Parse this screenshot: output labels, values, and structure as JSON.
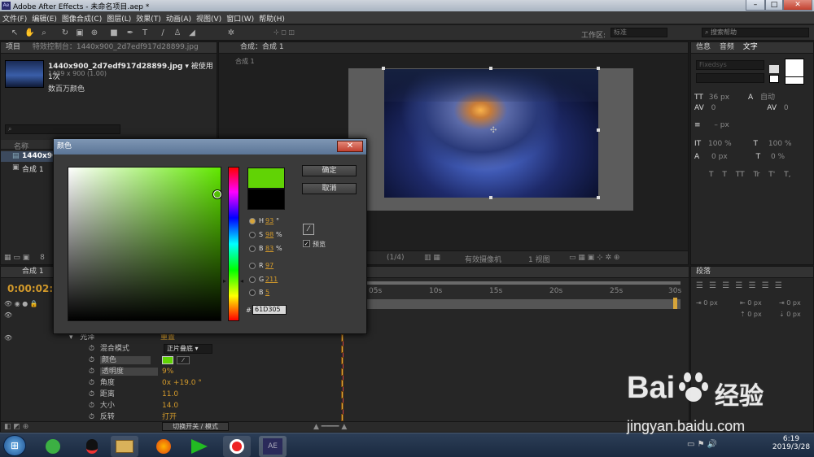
{
  "app": {
    "title": "Adobe After Effects - 未命名项目.aep *",
    "min": "–",
    "max": "□",
    "close": "✕",
    "ae_icon": "Ae"
  },
  "menu": [
    "文件(F)",
    "编辑(E)",
    "图像合成(C)",
    "图层(L)",
    "效果(T)",
    "动画(A)",
    "视图(V)",
    "窗口(W)",
    "帮助(H)"
  ],
  "toolbar": {
    "workspace_label": "工作区:",
    "workspace_value": "标准",
    "search_placeholder": "搜索帮助"
  },
  "project": {
    "tab_project": "项目",
    "tab_effects": "特效控制台：1440x900_2d7edf917d28899.jpg",
    "file_name": "1440x900_2d7edf917d28899.jpg",
    "used": "▾ 被使用 1次",
    "dims": "1439 x 900 (1.00)",
    "colors": "数百万颜色",
    "col_name": "名称",
    "items": [
      "1440x90",
      "合成 1"
    ],
    "bpc": "8"
  },
  "comp": {
    "tab": "合成：合成 1",
    "sub": "合成 1",
    "zoom": "(1/4)",
    "camera": "有效摄像机",
    "views": "1 视图"
  },
  "text_panel": {
    "tabs": [
      "信息",
      "音频",
      "文字"
    ],
    "font": "Fixedsys",
    "size": "36 px",
    "leading": "自动",
    "kern": "0",
    "tracking": "0",
    "stroke": "– px",
    "vscale": "100 %",
    "hscale": "100 %",
    "baseline": "0 px",
    "tsume": "0 %",
    "styles": [
      "T",
      "T",
      "TT",
      "Tr",
      "T'",
      "T,"
    ]
  },
  "paragraph": {
    "tab": "段落",
    "indent": [
      "0 px",
      "0 px",
      "0 px",
      "0 px",
      "0 px"
    ]
  },
  "timeline": {
    "tab": "合成 1",
    "timecode": "0:00:02:1",
    "ruler": [
      "05s",
      "10s",
      "15s",
      "20s",
      "25s",
      "30s"
    ],
    "group_name": "光泽",
    "group_reset": "重置",
    "props": [
      {
        "label": "混合模式",
        "value": "正片叠底"
      },
      {
        "label": "颜色",
        "value": ""
      },
      {
        "label": "透明度",
        "value": "9%"
      },
      {
        "label": "角度",
        "value": "0x +19.0 °"
      },
      {
        "label": "距离",
        "value": "11.0"
      },
      {
        "label": "大小",
        "value": "14.0"
      },
      {
        "label": "反转",
        "value": "打开"
      }
    ],
    "switch_mode": "切换开关 / 模式"
  },
  "color_dialog": {
    "title": "颜色",
    "ok": "确定",
    "cancel": "取消",
    "preview_label": "预览",
    "hash": "#",
    "hex": "61D305",
    "h_label": "H",
    "h_value": "93",
    "h_unit": "°",
    "s_label": "S",
    "s_value": "98",
    "s_unit": "%",
    "b_label": "B",
    "b_value": "83",
    "b_unit": "%",
    "r_label": "R",
    "r_value": "97",
    "g_label": "G",
    "g_value": "211",
    "bl_label": "B",
    "bl_value": "5",
    "new_color": "#61D305",
    "old_color": "#000000"
  },
  "taskbar": {
    "time": "6:19",
    "date": "2019/3/28",
    "ae": "AE"
  },
  "watermark": {
    "brand": "Bai",
    "brand2": "经验",
    "url": "jingyan.baidu.com"
  }
}
